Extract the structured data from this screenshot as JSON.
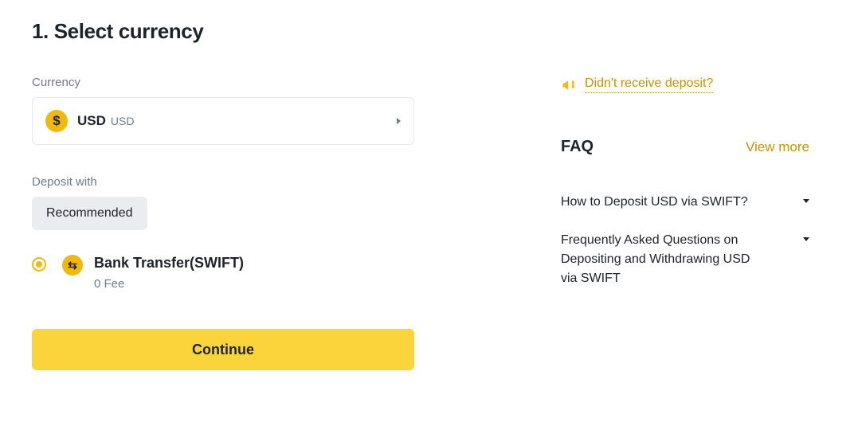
{
  "step": {
    "title": "1. Select currency",
    "currency_label": "Currency",
    "selected_currency_name": "USD",
    "selected_currency_code": "USD",
    "deposit_with_label": "Deposit with",
    "tab_recommended": "Recommended",
    "method_name": "Bank Transfer(SWIFT)",
    "method_fee": "0 Fee",
    "continue": "Continue"
  },
  "notice": {
    "text": "Didn't receive deposit?"
  },
  "faq": {
    "title": "FAQ",
    "view_more": "View more",
    "items": [
      "How to Deposit USD via SWIFT?",
      "Frequently Asked Questions on Depositing and Withdrawing USD via SWIFT"
    ]
  }
}
